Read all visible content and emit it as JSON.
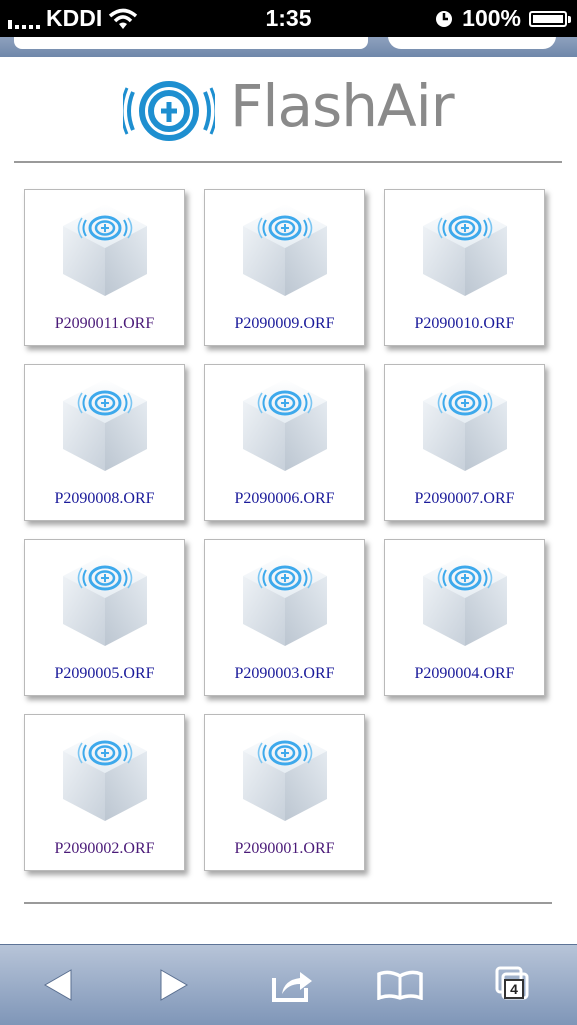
{
  "status_bar": {
    "carrier": "KDDI",
    "time": "1:35",
    "battery_text": "100%",
    "battery_level": 1.0
  },
  "logo": {
    "brand": "FlashAir"
  },
  "files": [
    {
      "name": "P2090011.ORF",
      "visited": true
    },
    {
      "name": "P2090009.ORF",
      "visited": false
    },
    {
      "name": "P2090010.ORF",
      "visited": false
    },
    {
      "name": "P2090008.ORF",
      "visited": false
    },
    {
      "name": "P2090006.ORF",
      "visited": false
    },
    {
      "name": "P2090007.ORF",
      "visited": false
    },
    {
      "name": "P2090005.ORF",
      "visited": false
    },
    {
      "name": "P2090003.ORF",
      "visited": false
    },
    {
      "name": "P2090004.ORF",
      "visited": false
    },
    {
      "name": "P2090002.ORF",
      "visited": true
    },
    {
      "name": "P2090001.ORF",
      "visited": true
    }
  ],
  "toolbar": {
    "tabs_count": "4",
    "icons": [
      "back-icon",
      "forward-icon",
      "share-icon",
      "bookmarks-icon",
      "tabs-icon"
    ]
  },
  "colors": {
    "link": "#1a1a9a",
    "visited_link": "#4a1a78",
    "toolbar": "#8ea1be",
    "logo_blue": "#1e8fd0"
  }
}
